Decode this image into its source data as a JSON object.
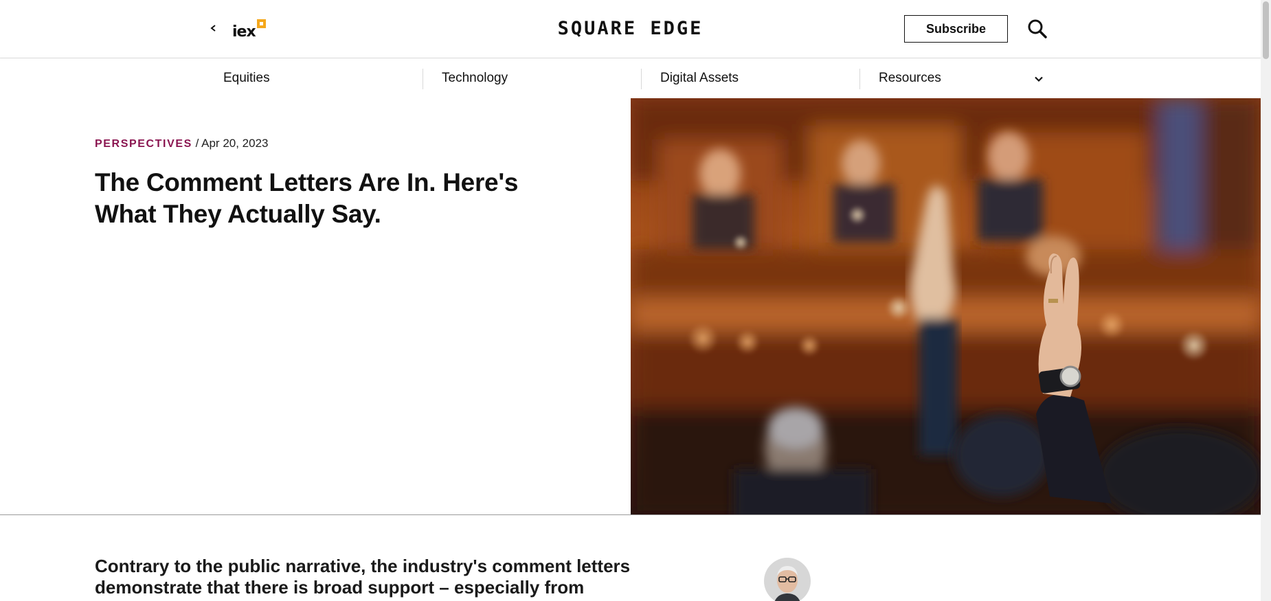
{
  "header": {
    "logo_text": "iex",
    "brand": "SQUARE EDGE",
    "subscribe_label": "Subscribe"
  },
  "nav": {
    "items": [
      {
        "label": "Equities"
      },
      {
        "label": "Technology"
      },
      {
        "label": "Digital Assets"
      },
      {
        "label": "Resources"
      }
    ]
  },
  "article": {
    "category": "PERSPECTIVES",
    "separator": " / ",
    "date": "Apr 20, 2023",
    "title": "The Comment Letters Are In. Here's What They Actually Say.",
    "lede": "Contrary to the public narrative, the industry's comment letters demonstrate that there is broad support – especially from"
  },
  "colors": {
    "category_accent": "#8a1550",
    "iex_accent": "#f5a81c"
  },
  "icons": {
    "back": "chevron-left-icon",
    "search": "search-icon",
    "resources_toggle": "chevron-down-icon"
  }
}
